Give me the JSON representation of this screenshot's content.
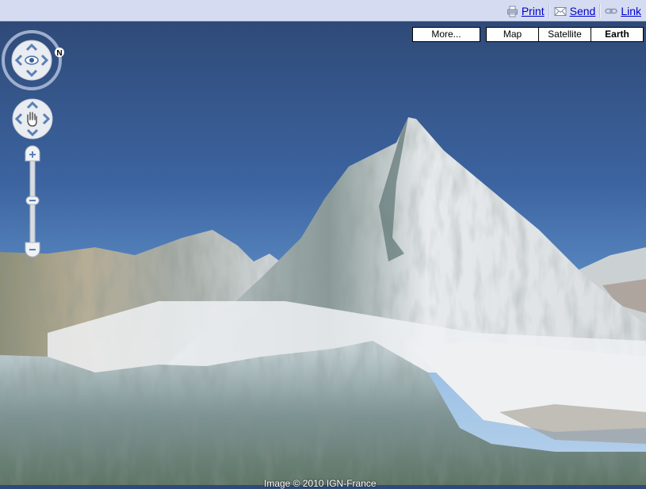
{
  "topbar": {
    "links": [
      {
        "label": "Print",
        "icon": "printer-icon"
      },
      {
        "label": "Send",
        "icon": "envelope-icon"
      },
      {
        "label": "Link",
        "icon": "chain-link-icon"
      }
    ]
  },
  "map_controls": {
    "more_label": "More...",
    "view_types": [
      {
        "label": "Map",
        "selected": false
      },
      {
        "label": "Satellite",
        "selected": false
      },
      {
        "label": "Earth",
        "selected": true
      }
    ],
    "compass_north_label": "N"
  },
  "view": {
    "mode": "Earth 3D",
    "subject": "snow-covered mountain peak"
  },
  "copyright": "Image © 2010 IGN-France",
  "colors": {
    "topbar_bg": "#d5dcf1",
    "link": "#0000cc",
    "sky_top": "#2f4a78",
    "sky_horizon": "#8fb4dc",
    "snow": "#e8ecef"
  }
}
